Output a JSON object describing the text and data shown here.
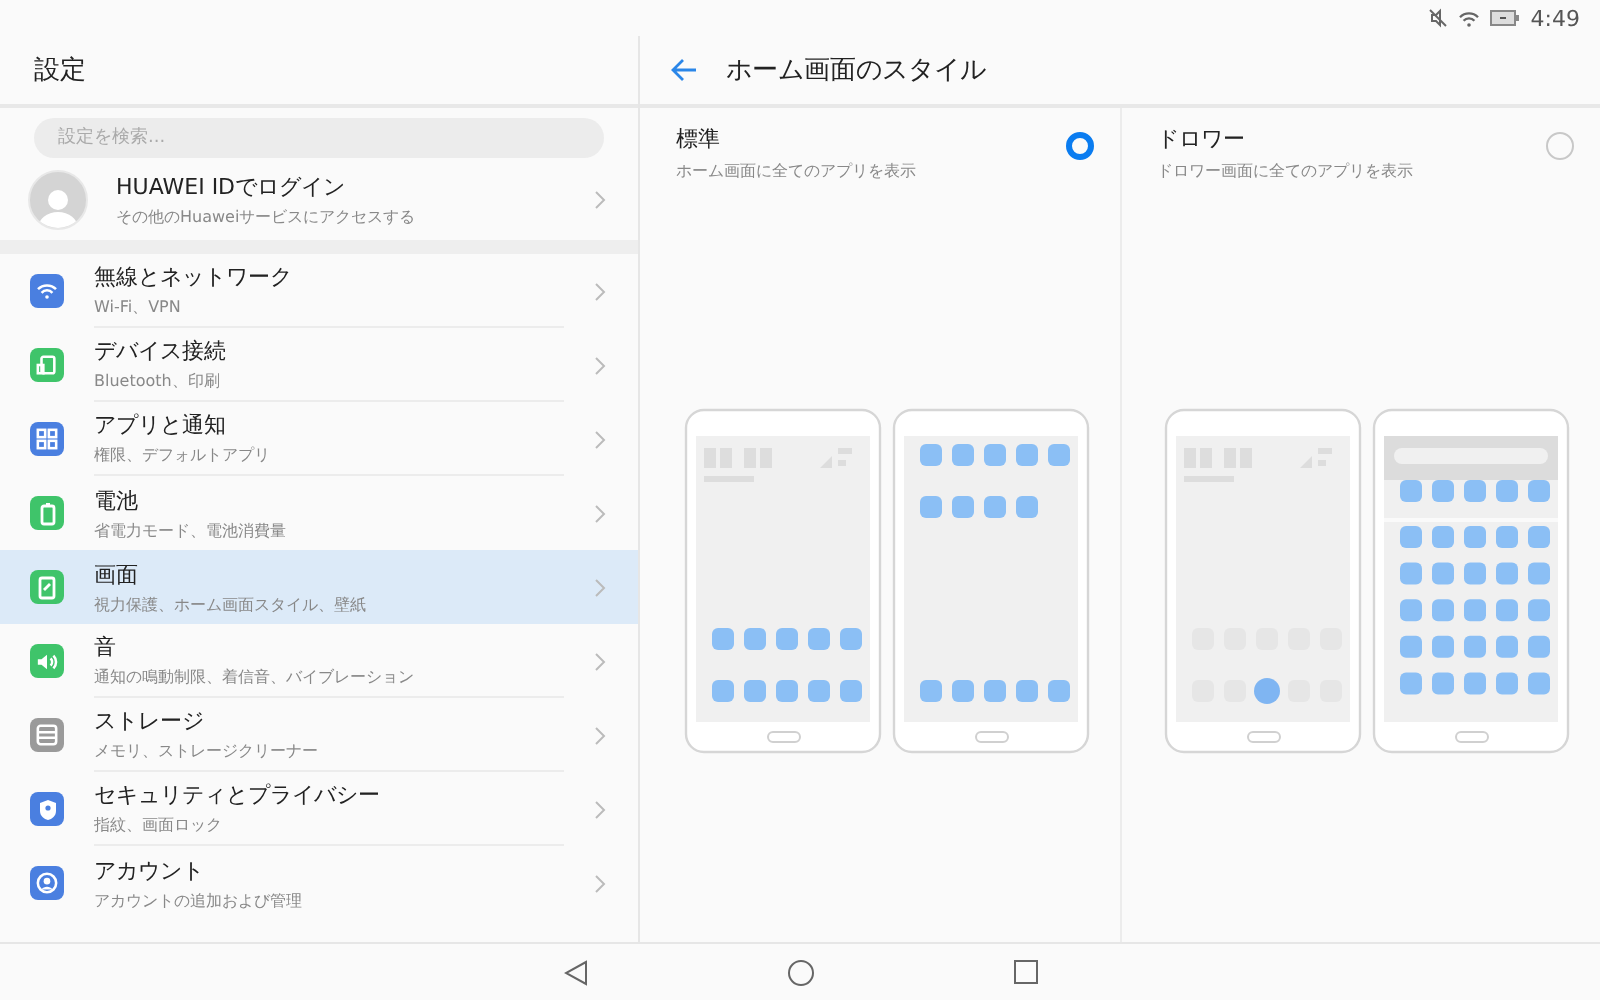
{
  "status_bar": {
    "time": "4:49"
  },
  "sidebar": {
    "title": "設定",
    "search": {
      "placeholder": "設定を検索..."
    },
    "account": {
      "title": "HUAWEI IDでログイン",
      "subtitle": "その他のHuaweiサービスにアクセスする"
    },
    "items": [
      {
        "kind": "wifi",
        "title": "無線とネットワーク",
        "subtitle": "Wi-Fi、VPN",
        "color": "#4a7fe0",
        "selected": false
      },
      {
        "kind": "devices",
        "title": "デバイス接続",
        "subtitle": "Bluetooth、印刷",
        "color": "#3fc46a",
        "selected": false
      },
      {
        "kind": "apps",
        "title": "アプリと通知",
        "subtitle": "権限、デフォルトアプリ",
        "color": "#4a7fe0",
        "selected": false
      },
      {
        "kind": "battery",
        "title": "電池",
        "subtitle": "省電力モード、電池消費量",
        "color": "#3fc46a",
        "selected": false
      },
      {
        "kind": "display",
        "title": "画面",
        "subtitle": "視力保護、ホーム画面スタイル、壁紙",
        "color": "#3fc46a",
        "selected": true
      },
      {
        "kind": "sound",
        "title": "音",
        "subtitle": "通知の鳴動制限、着信音、バイブレーション",
        "color": "#3fc46a",
        "selected": false
      },
      {
        "kind": "storage",
        "title": "ストレージ",
        "subtitle": "メモリ、ストレージクリーナー",
        "color": "#9a9a9a",
        "selected": false
      },
      {
        "kind": "security",
        "title": "セキュリティとプライバシー",
        "subtitle": "指紋、画面ロック",
        "color": "#4a7fe0",
        "selected": false
      },
      {
        "kind": "account",
        "title": "アカウント",
        "subtitle": "アカウントの追加および管理",
        "color": "#4a7fe0",
        "selected": false
      }
    ]
  },
  "detail": {
    "title": "ホーム画面のスタイル",
    "options": [
      {
        "kind": "standard",
        "title": "標準",
        "subtitle": "ホーム画面に全てのアプリを表示",
        "selected": true
      },
      {
        "kind": "drawer",
        "title": "ドロワー",
        "subtitle": "ドロワー画面に全てのアプリを表示",
        "selected": false
      }
    ]
  }
}
